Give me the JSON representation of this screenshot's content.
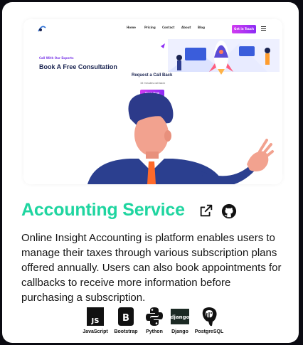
{
  "project": {
    "title": "Accounting Service",
    "description": "Online Insight Accounting is platform enables users to manage their taxes through various subscription plans offered annually. Users can also book appointments for callbacks to receive more information before purchasing a subscription.",
    "links": {
      "external_icon": "external-link-icon",
      "source_icon": "github-icon"
    }
  },
  "preview": {
    "nav": {
      "links": [
        "Home",
        "Pricing",
        "Contact",
        "About",
        "Blog"
      ],
      "cta": "Get in Touch"
    },
    "kicker": "Call With Our Experts",
    "heading": "Book A Free Consultation",
    "callback_title": "Request a Call Back",
    "callback_sub": "15 minutes call back",
    "callback_button": "Book Now"
  },
  "tech_stack": [
    {
      "name": "JavaScript",
      "icon": "javascript-icon"
    },
    {
      "name": "Bootstrap",
      "icon": "bootstrap-icon"
    },
    {
      "name": "Python",
      "icon": "python-icon"
    },
    {
      "name": "Django",
      "icon": "django-icon"
    },
    {
      "name": "PostgreSQL",
      "icon": "postgresql-icon"
    }
  ],
  "colors": {
    "title": "#1fd5a0",
    "page_bg": "#0b0b12",
    "card_bg": "#ffffff",
    "accent_purple": "#8c2bf5"
  }
}
